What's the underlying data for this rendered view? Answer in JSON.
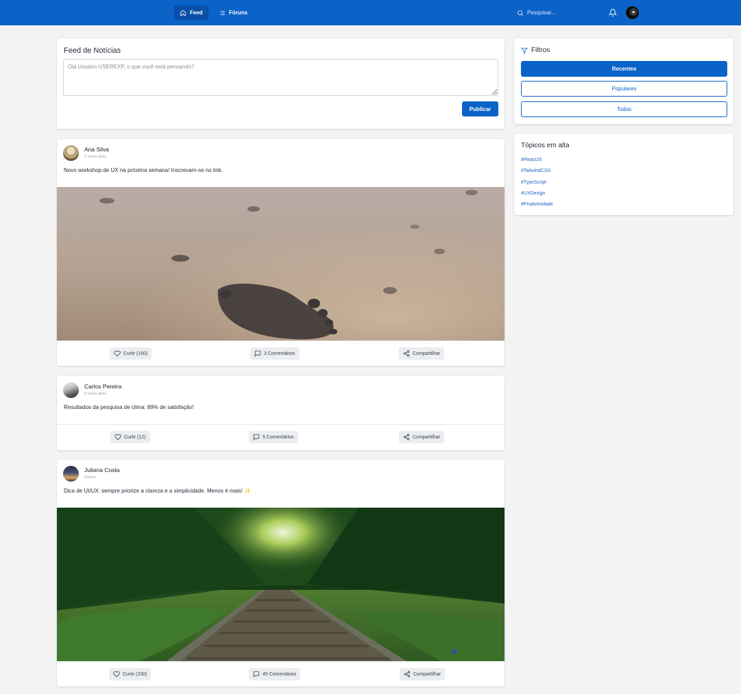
{
  "nav": {
    "feed_label": "Feed",
    "forums_label": "Fóruns",
    "search_placeholder": "Pesquisar..."
  },
  "composer": {
    "title": "Feed de Notícias",
    "placeholder": "Olá Usuário USEREXP, o que você está pensando?",
    "publish_label": "Publicar"
  },
  "posts": [
    {
      "author": "Ana Silva",
      "time": "2 horas atrás",
      "text": "Novo workshop de UX na próxima semana! Inscrevam-se no link.",
      "like_label": "Curtir (150)",
      "comments_label": "3 Comentários",
      "share_label": "Compartilhar"
    },
    {
      "author": "Carlos Pereira",
      "time": "5 horas atrás",
      "text": "Resultados da pesquisa de clima: 89% de satisfação!",
      "like_label": "Curtir (12)",
      "comments_label": "5 Comentários",
      "share_label": "Compartilhar"
    },
    {
      "author": "Juliana Costa",
      "time": "Ontem",
      "text": "Dica de UI/UX: sempre priorize a clareza e a simplicidade. Menos é mais! ✨",
      "like_label": "Curtir (230)",
      "comments_label": "45 Comentários",
      "share_label": "Compartilhar"
    }
  ],
  "filters": {
    "title": "Filtros",
    "recent": "Recentes",
    "popular": "Populares",
    "all": "Todos"
  },
  "trending": {
    "title": "Tópicos em alta",
    "topics": [
      "#ReactJS",
      "#TailwindCSS",
      "#TypeScript",
      "#UXDesign",
      "#Produtividade"
    ]
  },
  "colors": {
    "primary": "#0b63c8",
    "background": "#f3f3f4",
    "link": "#2563c9"
  }
}
